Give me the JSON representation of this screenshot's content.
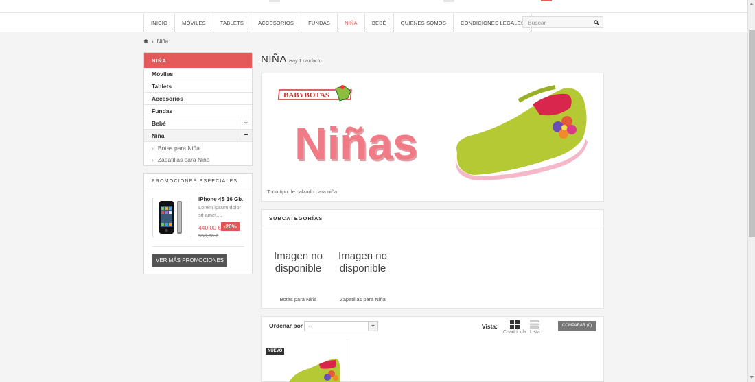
{
  "nav": {
    "items": [
      "INICIO",
      "MÓVILES",
      "TABLETS",
      "ACCESORIOS",
      "FUNDAS",
      "NIÑA",
      "BEBÉ",
      "QUIENES SOMOS",
      "CONDICIONES LEGALES"
    ],
    "active_index": 5,
    "search_placeholder": "Buscar",
    "search_icon": "magnifier-icon"
  },
  "breadcrumb": {
    "home_icon": "home-icon",
    "current": "Niña"
  },
  "sidebar": {
    "title": "NIÑA",
    "items": [
      {
        "label": "Móviles"
      },
      {
        "label": "Tablets"
      },
      {
        "label": "Accesorios"
      },
      {
        "label": "Fundas"
      },
      {
        "label": "Bebé",
        "toggle": "+"
      },
      {
        "label": "Niña",
        "toggle": "−"
      }
    ],
    "subitems": [
      "Botas para Niña",
      "Zapatillas para Niña"
    ]
  },
  "promo": {
    "title": "PROMOCIONES ESPECIALES",
    "product_name": "iPhone 4S 16 Gb.",
    "description": "Lorem ipsum dolor sit amet,...",
    "price": "440,00 €",
    "discount": "-20%",
    "old_price": "550,00 €",
    "button": "VER MÁS PROMOCIONES"
  },
  "page": {
    "title": "NIÑA",
    "count": "Hay 1 producto.",
    "banner": {
      "brand": "BABYBOTAS",
      "headline": "Niñas"
    },
    "description": "Todo tipo de calzado para niña."
  },
  "subcategories": {
    "title": "SUBCATEGORÍAS",
    "placeholder_line1": "Imagen no",
    "placeholder_line2": "disponible",
    "items": [
      "Botas para Niña",
      "Zapatillas para Niña"
    ]
  },
  "sorting": {
    "label": "Ordenar por",
    "value": "--",
    "view_label": "Vista:",
    "grid_label": "Cuadrícula",
    "list_label": "Lista",
    "compare": "COMPARAR (0)"
  },
  "products": [
    {
      "badge": "NUEVO"
    }
  ],
  "colors": {
    "accent": "#e45a5a",
    "dark": "#555555"
  }
}
